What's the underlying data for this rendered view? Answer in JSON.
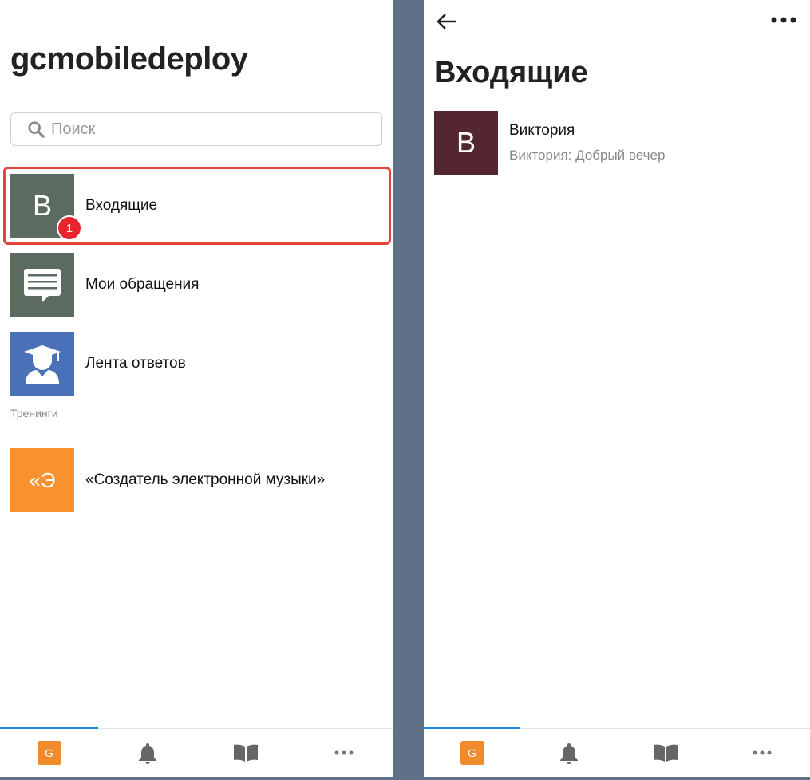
{
  "left": {
    "app_title": "gcmobiledeploy",
    "search_placeholder": "Поиск",
    "items": [
      {
        "avatar_letter": "В",
        "label": "Входящие",
        "badge": "1",
        "color": "#5c6b60"
      },
      {
        "label": "Мои обращения",
        "icon": "chat-bubble-icon",
        "color": "#5c6b60"
      },
      {
        "label": "Лента ответов",
        "icon": "graduate-icon",
        "color": "#4a71b8"
      }
    ],
    "section_label": "Тренинги",
    "training": {
      "avatar_text": "«Э",
      "label": "«Создатель электронной музыки»",
      "color": "#f7922e"
    }
  },
  "right": {
    "page_title": "Входящие",
    "conversation": {
      "avatar_letter": "В",
      "name": "Виктория",
      "preview": "Виктория: Добрый вечер",
      "color": "#532631"
    }
  },
  "tabbar": {
    "tabs": [
      {
        "icon": "g-app-icon",
        "text": "G",
        "active": true
      },
      {
        "icon": "bell-icon"
      },
      {
        "icon": "book-icon"
      },
      {
        "icon": "more-horizontal-icon"
      }
    ],
    "accent": "#1e88e5"
  }
}
